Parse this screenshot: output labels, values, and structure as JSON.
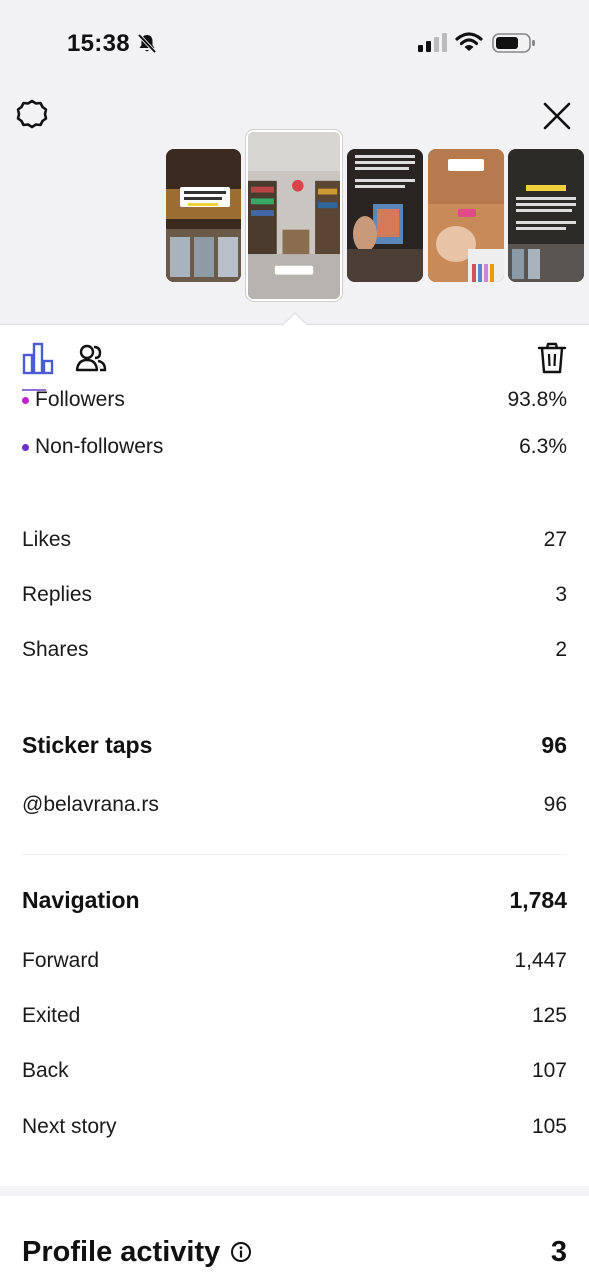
{
  "status_bar": {
    "time": "15:38"
  },
  "audience": [
    {
      "label": "Followers",
      "value": "93.8%",
      "dot_color": "#c21fd1"
    },
    {
      "label": "Non-followers",
      "value": "6.3%",
      "dot_color": "#6b2fcc"
    }
  ],
  "interactions": [
    {
      "label": "Likes",
      "value": "27"
    },
    {
      "label": "Replies",
      "value": "3"
    },
    {
      "label": "Shares",
      "value": "2"
    }
  ],
  "sticker_taps": {
    "title": "Sticker taps",
    "total": "96",
    "items": [
      {
        "label": "@belavrana.rs",
        "value": "96"
      }
    ]
  },
  "navigation": {
    "title": "Navigation",
    "total": "1,784",
    "items": [
      {
        "label": "Forward",
        "value": "1,447"
      },
      {
        "label": "Exited",
        "value": "125"
      },
      {
        "label": "Back",
        "value": "107"
      },
      {
        "label": "Next story",
        "value": "105"
      }
    ]
  },
  "profile_activity": {
    "title": "Profile activity",
    "value": "3"
  },
  "thumbnail_sticker": "@belavrana.rs",
  "colors": {
    "accent": "#4a5bd4",
    "follower_dot": "#c21fd1",
    "nonfollower_dot": "#6b2fcc"
  }
}
